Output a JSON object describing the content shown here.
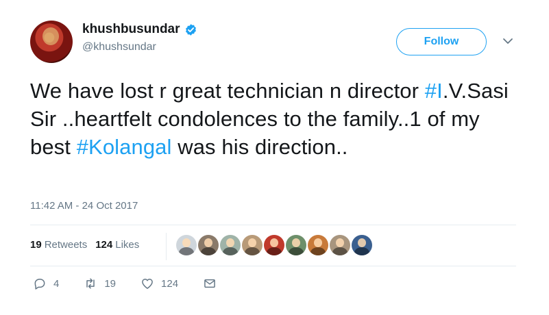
{
  "user": {
    "display_name": "khushbusundar",
    "handle": "@khushsundar",
    "verified": true
  },
  "follow_label": "Follow",
  "tweet": {
    "segments": [
      {
        "text": "We have lost r great technician n director ",
        "hashtag": false
      },
      {
        "text": "#I",
        "hashtag": true
      },
      {
        "text": ".V.Sasi Sir ..heartfelt condolences to the family..1 of my best ",
        "hashtag": false
      },
      {
        "text": "#Kolangal",
        "hashtag": true
      },
      {
        "text": " was his direction..",
        "hashtag": false
      }
    ]
  },
  "timestamp": "11:42 AM - 24 Oct 2017",
  "stats": {
    "retweets_count": "19",
    "retweets_label": "Retweets",
    "likes_count": "124",
    "likes_label": "Likes"
  },
  "liker_avatars": [
    {
      "color": "#cfd6dc"
    },
    {
      "color": "#8a7a6a"
    },
    {
      "color": "#9fb3a8"
    },
    {
      "color": "#b89a78"
    },
    {
      "color": "#c0392b"
    },
    {
      "color": "#6d8f6a"
    },
    {
      "color": "#c87a3a"
    },
    {
      "color": "#a8957e"
    },
    {
      "color": "#3a5f8f"
    }
  ],
  "actions": {
    "reply_count": "4",
    "retweet_count": "19",
    "like_count": "124",
    "reply_icon": "reply-icon",
    "retweet_icon": "retweet-icon",
    "like_icon": "heart-icon",
    "dm_icon": "envelope-icon"
  },
  "colors": {
    "accent": "#1da1f2",
    "text": "#14171a",
    "muted": "#657786"
  }
}
